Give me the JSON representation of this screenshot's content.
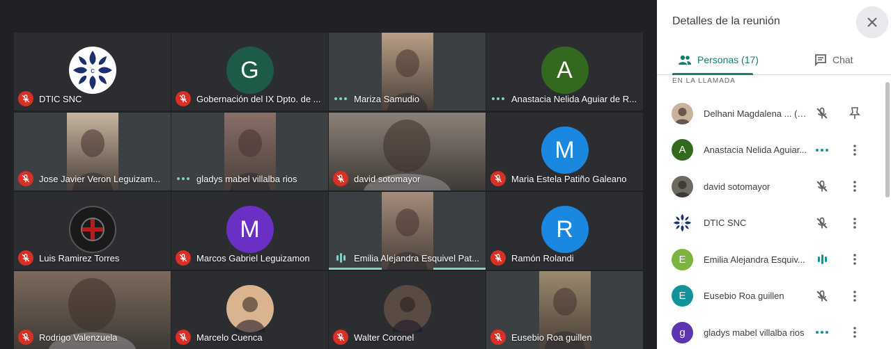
{
  "panel": {
    "title": "Detalles de la reunión",
    "tabs": [
      {
        "label": "Personas (17)",
        "icon": "people-icon",
        "active": true
      },
      {
        "label": "Chat",
        "icon": "chat-icon",
        "active": false
      }
    ],
    "section_label": "EN LA LLAMADA",
    "people": [
      {
        "name": "Delhani Magdalena ... (Tú)",
        "avatar": "photo",
        "avatar_color": "#c9b29a",
        "status": "mic-off",
        "action": "pin-icon"
      },
      {
        "name": "Anastacia Nelida Aguiar...",
        "avatar": "A",
        "avatar_color": "#33691e",
        "status": "dots",
        "action": "more-icon"
      },
      {
        "name": "david sotomayor",
        "avatar": "photo",
        "avatar_color": "#6d6a62",
        "status": "mic-off",
        "action": "more-icon"
      },
      {
        "name": "DTIC SNC",
        "avatar": "logo",
        "avatar_color": "#ffffff",
        "status": "mic-off",
        "action": "more-icon"
      },
      {
        "name": "Emilia Alejandra Esquiv...",
        "avatar": "E",
        "avatar_color": "#7cb342",
        "status": "wave",
        "action": "more-icon"
      },
      {
        "name": "Eusebio Roa guillen",
        "avatar": "E",
        "avatar_color": "#12939a",
        "status": "mic-off",
        "action": "more-icon"
      },
      {
        "name": "gladys mabel villalba rios",
        "avatar": "g",
        "avatar_color": "#5e35b1",
        "status": "dots",
        "action": "more-icon"
      }
    ]
  },
  "tiles": [
    {
      "name": "DTIC SNC",
      "status": "mic-off",
      "kind": "logo"
    },
    {
      "name": "Gobernación del IX Dpto. de ...",
      "status": "mic-off",
      "kind": "letter",
      "letter": "G",
      "color": "#1e5a48"
    },
    {
      "name": "Mariza Samudio",
      "status": "dots",
      "kind": "video",
      "color": "#b89f86"
    },
    {
      "name": "Anastacia Nelida Aguiar de R...",
      "status": "dots",
      "kind": "letter",
      "letter": "A",
      "color": "#33691e"
    },
    {
      "name": "Jose Javier Veron Leguizam...",
      "status": "mic-off",
      "kind": "video",
      "color": "#c8b6a0"
    },
    {
      "name": "gladys mabel villalba rios",
      "status": "dots",
      "kind": "video",
      "color": "#8a6e6a"
    },
    {
      "name": "david sotomayor",
      "status": "mic-off",
      "kind": "video-wide",
      "color": "#8c8178"
    },
    {
      "name": "Maria Estela Patiño Galeano",
      "status": "mic-off",
      "kind": "letter",
      "letter": "M",
      "color": "#1a88e0"
    },
    {
      "name": "Luis Ramirez Torres",
      "status": "mic-off",
      "kind": "cross-logo"
    },
    {
      "name": "Marcos Gabriel Leguizamon",
      "status": "mic-off",
      "kind": "letter",
      "letter": "M",
      "color": "#6a2fc4"
    },
    {
      "name": "Emilia Alejandra Esquivel Pat...",
      "status": "wave",
      "kind": "video",
      "color": "#a48c7c",
      "active": true
    },
    {
      "name": "Ramón Rolandi",
      "status": "mic-off",
      "kind": "letter",
      "letter": "R",
      "color": "#1a88e0"
    },
    {
      "name": "Rodrigo Valenzuela",
      "status": "mic-off",
      "kind": "video-wide",
      "color": "#7c6a5c"
    },
    {
      "name": "Marcelo Cuenca",
      "status": "mic-off",
      "kind": "photo-circle",
      "color": "#d9b48e"
    },
    {
      "name": "Walter Coronel",
      "status": "mic-off",
      "kind": "photo-circle",
      "color": "#5a4a44"
    },
    {
      "name": "Eusebio Roa guillen",
      "status": "mic-off",
      "kind": "video",
      "color": "#9a8a6c"
    }
  ]
}
